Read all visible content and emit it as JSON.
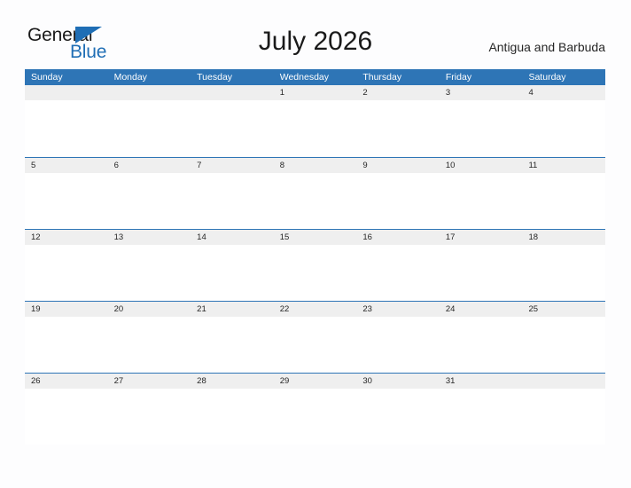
{
  "brand": {
    "word_one": "General",
    "word_two": "Blue",
    "triangle_icon": "triangle-icon",
    "accent_color": "#1f6eb5"
  },
  "header": {
    "title": "July 2026",
    "locale": "Antigua and Barbuda"
  },
  "calendar": {
    "header_color": "#2e75b6",
    "band_color": "#efefef",
    "weekdays": [
      "Sunday",
      "Monday",
      "Tuesday",
      "Wednesday",
      "Thursday",
      "Friday",
      "Saturday"
    ],
    "weeks": [
      [
        "",
        "",
        "",
        "1",
        "2",
        "3",
        "4"
      ],
      [
        "5",
        "6",
        "7",
        "8",
        "9",
        "10",
        "11"
      ],
      [
        "12",
        "13",
        "14",
        "15",
        "16",
        "17",
        "18"
      ],
      [
        "19",
        "20",
        "21",
        "22",
        "23",
        "24",
        "25"
      ],
      [
        "26",
        "27",
        "28",
        "29",
        "30",
        "31",
        ""
      ]
    ]
  }
}
